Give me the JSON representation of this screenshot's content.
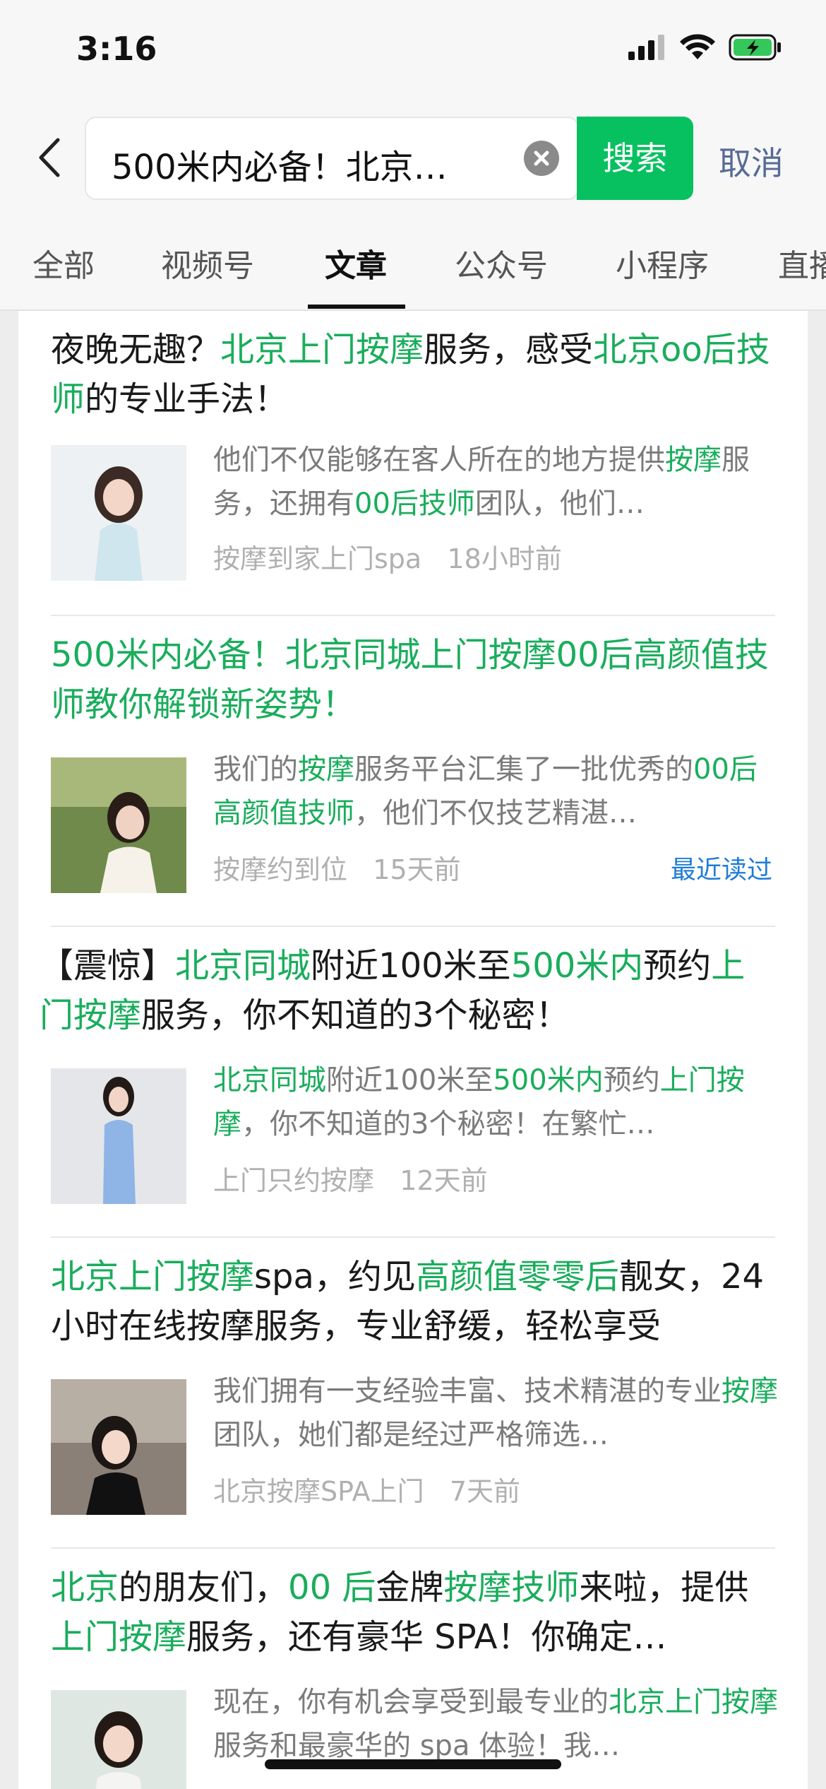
{
  "status_bar": {
    "time": "3:16"
  },
  "search": {
    "query": "500米内必备！北京…",
    "search_button": "搜索",
    "cancel": "取消"
  },
  "tabs": [
    "全部",
    "视频号",
    "文章",
    "公众号",
    "小程序",
    "直播"
  ],
  "active_tab": "文章",
  "colors": {
    "accent_green": "#07c160",
    "highlight_green": "#1aad5c",
    "link_blue": "#576b95",
    "read_blue": "#1f7cd6"
  },
  "articles": [
    {
      "title": [
        {
          "t": "夜晚无趣？"
        },
        {
          "t": "北京上门按摩",
          "h": true
        },
        {
          "t": "服务，感受"
        },
        {
          "t": "北京oo后技师",
          "h": true
        },
        {
          "t": "的专业手法！"
        }
      ],
      "snippet": [
        {
          "t": "他们不仅能够在客人所在的地方提供"
        },
        {
          "t": "按摩",
          "h": true
        },
        {
          "t": "服务，还拥有"
        },
        {
          "t": "00后技师",
          "h": true
        },
        {
          "t": "团队，他们…"
        }
      ],
      "source": "按摩到家上门spa",
      "time": "18小时前",
      "read_label": ""
    },
    {
      "title": [
        {
          "t": "500米内必备！北京同城上门按摩00后高颜值技师教你解锁新姿势！",
          "h": true
        }
      ],
      "snippet": [
        {
          "t": "我们的"
        },
        {
          "t": "按摩",
          "h": true
        },
        {
          "t": "服务平台汇集了一批优秀的"
        },
        {
          "t": "00后高颜值技师",
          "h": true
        },
        {
          "t": "，他们不仅技艺精湛…"
        }
      ],
      "source": "按摩约到位",
      "time": "15天前",
      "read_label": "最近读过"
    },
    {
      "title": [
        {
          "t": "【震惊】"
        },
        {
          "t": "北京同城",
          "h": true
        },
        {
          "t": "附近100米至"
        },
        {
          "t": "500米内",
          "h": true
        },
        {
          "t": "预约"
        },
        {
          "t": "上门按摩",
          "h": true
        },
        {
          "t": "服务，你不知道的3个秘密！"
        }
      ],
      "snippet": [
        {
          "t": "北京同城",
          "h": true
        },
        {
          "t": "附近100米至"
        },
        {
          "t": "500米内",
          "h": true
        },
        {
          "t": "预约"
        },
        {
          "t": "上门按摩",
          "h": true
        },
        {
          "t": "，你不知道的3个秘密！在繁忙…"
        }
      ],
      "source": "上门只约按摩",
      "time": "12天前",
      "read_label": ""
    },
    {
      "title": [
        {
          "t": "北京上门按摩",
          "h": true
        },
        {
          "t": "spa，约见"
        },
        {
          "t": "高颜值零零后",
          "h": true
        },
        {
          "t": "靓女，24小时在线按摩服务，专业舒缓，轻松享受"
        }
      ],
      "snippet": [
        {
          "t": "我们拥有一支经验丰富、技术精湛的专业"
        },
        {
          "t": "按摩",
          "h": true
        },
        {
          "t": "团队，她们都是经过严格筛选…"
        }
      ],
      "source": "北京按摩SPA上门",
      "time": "7天前",
      "read_label": ""
    },
    {
      "title": [
        {
          "t": "北京",
          "h": true
        },
        {
          "t": "的朋友们，"
        },
        {
          "t": "00 后",
          "h": true
        },
        {
          "t": "金牌"
        },
        {
          "t": "按摩技师",
          "h": true
        },
        {
          "t": "来啦，提供"
        },
        {
          "t": "上门按摩",
          "h": true
        },
        {
          "t": "服务，还有豪华 SPA！你确定…"
        }
      ],
      "snippet": [
        {
          "t": "现在，你有机会享受到最专业的"
        },
        {
          "t": "北京上门按摩",
          "h": true
        },
        {
          "t": "服务和最豪华的 spa 体验！我…"
        }
      ],
      "source": "",
      "time": "",
      "read_label": ""
    }
  ]
}
